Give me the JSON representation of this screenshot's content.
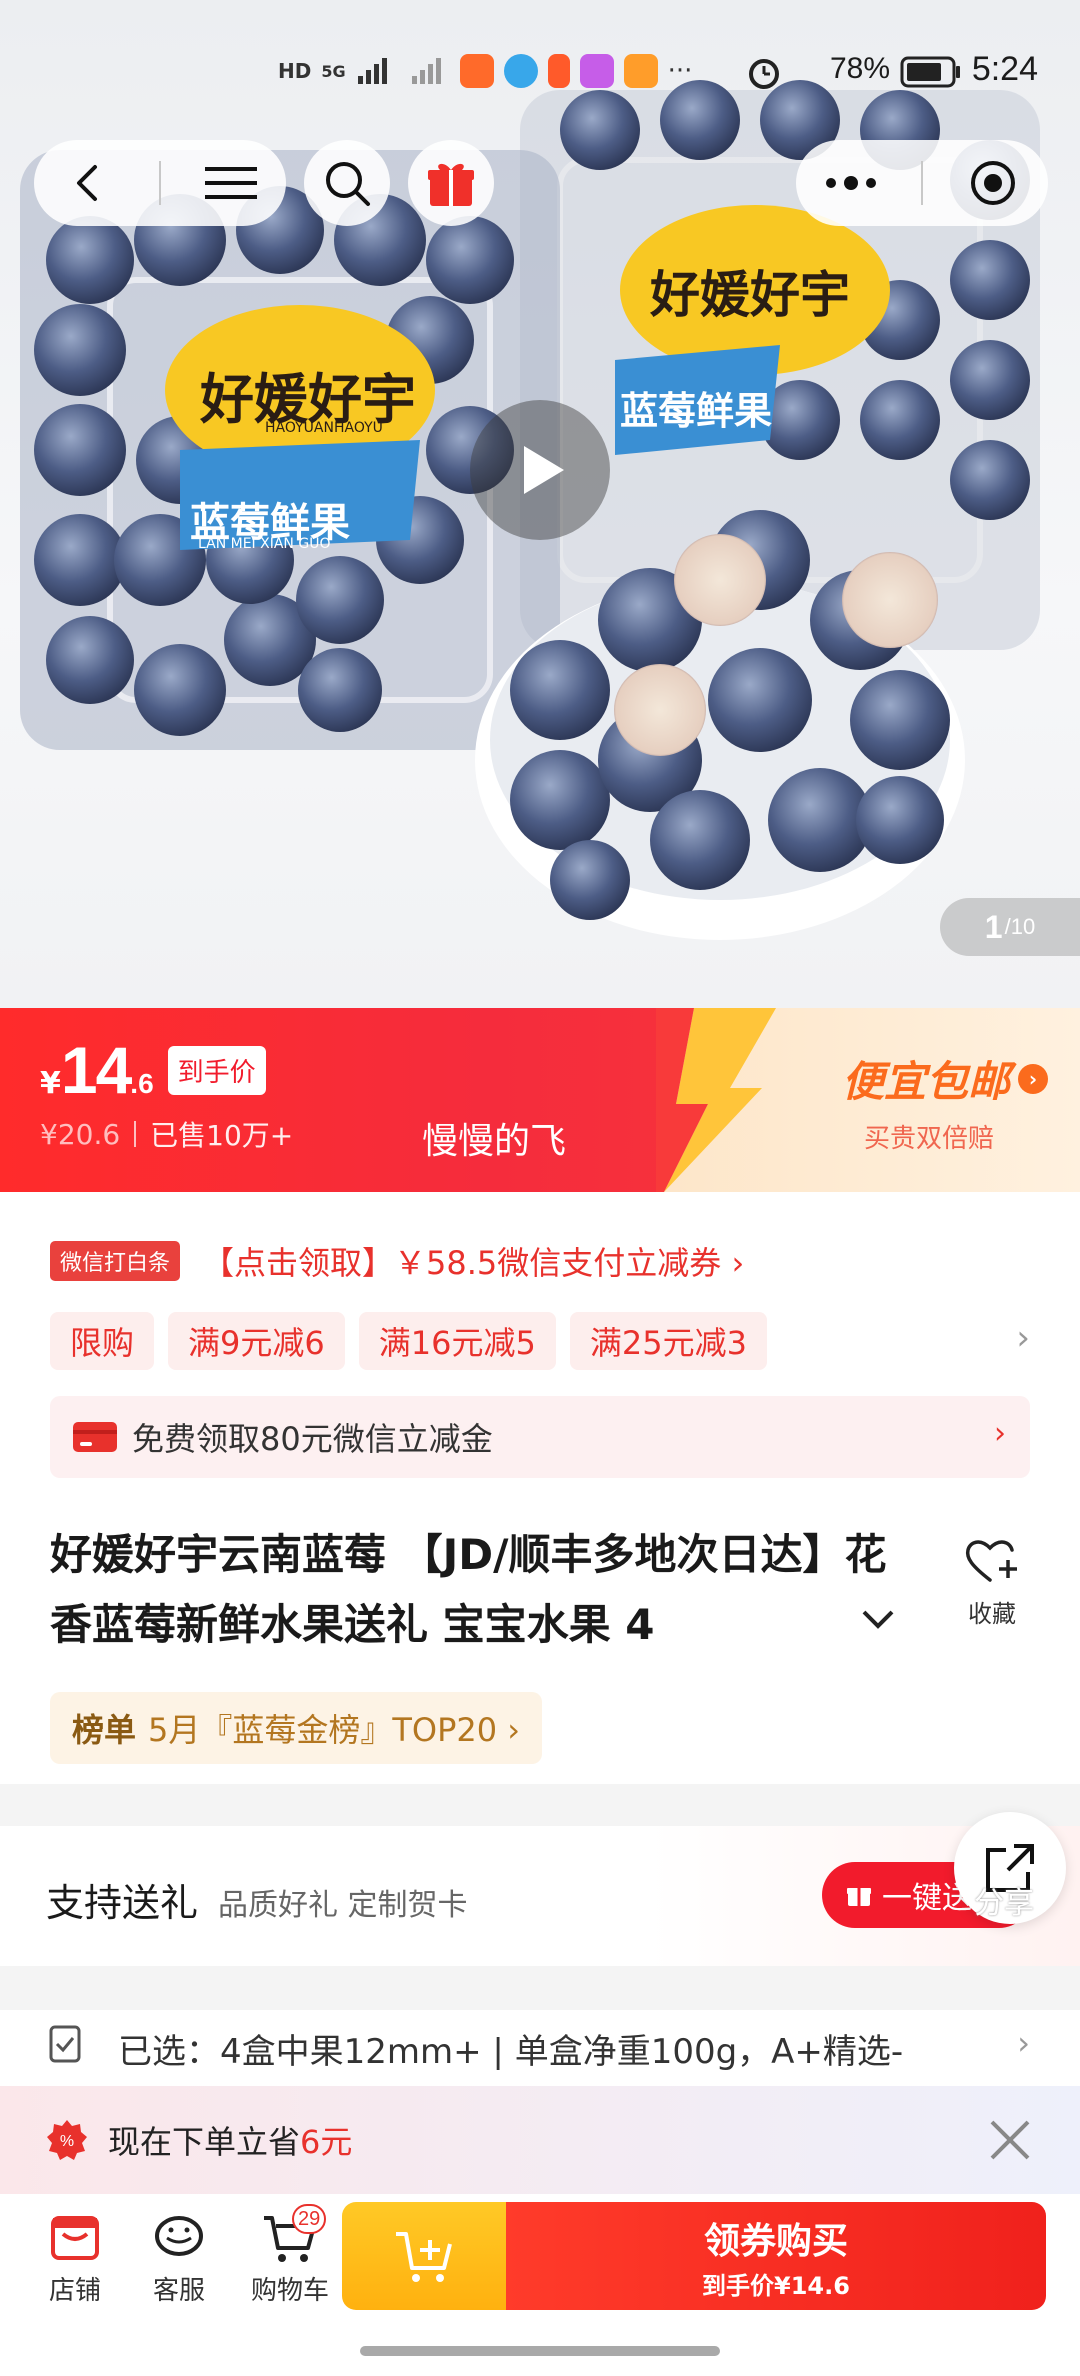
{
  "status_bar": {
    "network": "HD",
    "signal": "5G",
    "battery_percent": "78%",
    "time": "5:24"
  },
  "hero": {
    "brand_label": "好媛好宇",
    "brand_pinyin": "HAOYUANHAOYU",
    "product_label": "蓝莓鲜果",
    "product_pinyin": "LAN MEI XIAN GUO",
    "pager_current": "1",
    "pager_total": "/10"
  },
  "price_banner": {
    "currency": "¥",
    "price_integer": "14",
    "price_decimal": ".6",
    "price_tag": "到手价",
    "original_price": "¥20.6",
    "sold": "已售10万+",
    "seller": "慢慢的飞",
    "cheap_title": "便宜包邮",
    "cheap_sub": "买贵双倍赔"
  },
  "coupons": {
    "wechat_badge": "微信打白条",
    "wechat_offer": "【点击领取】￥58.5微信支付立减券 ›",
    "chips": [
      "限购",
      "满9元减6",
      "满16元减5",
      "满25元减3"
    ],
    "free_text": "免费领取80元微信立减金"
  },
  "product": {
    "title": "好媛好宇云南蓝莓 【JD/顺丰多地次日达】花香蓝莓新鲜水果送礼 宝宝水果 4",
    "favorite_label": "收藏",
    "rank_label": "榜单",
    "rank_text": "5月『蓝莓金榜』TOP20 ›"
  },
  "gift": {
    "title": "支持送礼",
    "subtitle": "品质好礼 定制贺卡",
    "button": "一键送",
    "share": "分享"
  },
  "selection": {
    "text": "已选：4盒中果12mm+ | 单盒净重100g，A+精选-"
  },
  "promo": {
    "text_prefix": "现在下单立省",
    "amount": "6元"
  },
  "bottom_bar": {
    "shop": "店铺",
    "service": "客服",
    "cart": "购物车",
    "cart_count": "29",
    "buy_title": "领券购买",
    "buy_sub": "到手价¥14.6"
  },
  "colors": {
    "brand_red": "#f21b2c",
    "promo_orange": "#fb6b1d",
    "gold": "#ffb10f"
  },
  "icons": [
    "back-icon",
    "menu-icon",
    "search-icon",
    "gift-icon",
    "more-icon",
    "target-icon",
    "play-icon",
    "heart-plus-icon",
    "share-icon",
    "shop-icon",
    "service-icon",
    "cart-icon",
    "add-cart-icon",
    "close-icon",
    "discount-icon",
    "wallet-icon",
    "sku-icon"
  ]
}
